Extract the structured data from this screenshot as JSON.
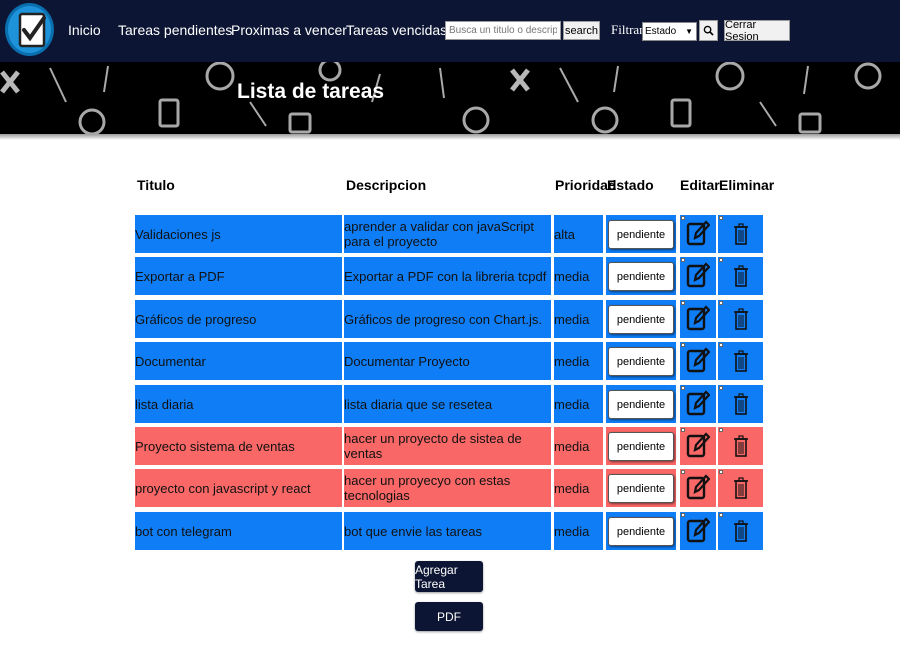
{
  "navbar": {
    "links": [
      "Inicio",
      "Tareas pendientes",
      "Proximas a vencer",
      "Tareas vencidas"
    ],
    "search_placeholder": "Busca un titulo o descripcion",
    "search_button": "search",
    "filter_label": "Filtrar",
    "filter_selected": "Estado",
    "filter_button_icon": "search-icon",
    "logout_button": "Cerrar Sesion"
  },
  "banner": {
    "title": "Lista de tareas"
  },
  "table": {
    "headers": [
      "Titulo",
      "Descripcion",
      "Prioridad",
      "Estado",
      "Editar",
      "Eliminar"
    ],
    "rows": [
      {
        "titulo": "Validaciones js",
        "descripcion": "aprender a validar con javaScript para el proyecto",
        "prioridad": "alta",
        "estado": "pendiente",
        "color": "#0f7df6"
      },
      {
        "titulo": "Exportar a PDF",
        "descripcion": "Exportar a PDF con la libreria tcpdf",
        "prioridad": "media",
        "estado": "pendiente",
        "color": "#0f7df6"
      },
      {
        "titulo": "Gráficos de progreso",
        "descripcion": "Gráficos de progreso con Chart.js.",
        "prioridad": "media",
        "estado": "pendiente",
        "color": "#0f7df6"
      },
      {
        "titulo": "Documentar",
        "descripcion": "Documentar Proyecto",
        "prioridad": "media",
        "estado": "pendiente",
        "color": "#0f7df6"
      },
      {
        "titulo": "lista diaria",
        "descripcion": "lista diaria que se resetea",
        "prioridad": "media",
        "estado": "pendiente",
        "color": "#0f7df6"
      },
      {
        "titulo": "Proyecto sistema de ventas",
        "descripcion": "hacer un proyecto de sistea de ventas",
        "prioridad": "media",
        "estado": "pendiente",
        "color": "#f96767"
      },
      {
        "titulo": "proyecto con javascript y react",
        "descripcion": "hacer un proyecyo con estas tecnologias",
        "prioridad": "media",
        "estado": "pendiente",
        "color": "#f96767"
      },
      {
        "titulo": "bot con telegram",
        "descripcion": "bot que envie las tareas",
        "prioridad": "media",
        "estado": "pendiente",
        "color": "#0f7df6"
      }
    ],
    "edit_icon": "edit-icon",
    "delete_icon": "trash-icon"
  },
  "actions": {
    "add_button": "Agregar Tarea",
    "pdf_button": "PDF"
  },
  "colors": {
    "navbar": "#0c1533",
    "row_blue": "#0f7df6",
    "row_red": "#f96767"
  }
}
